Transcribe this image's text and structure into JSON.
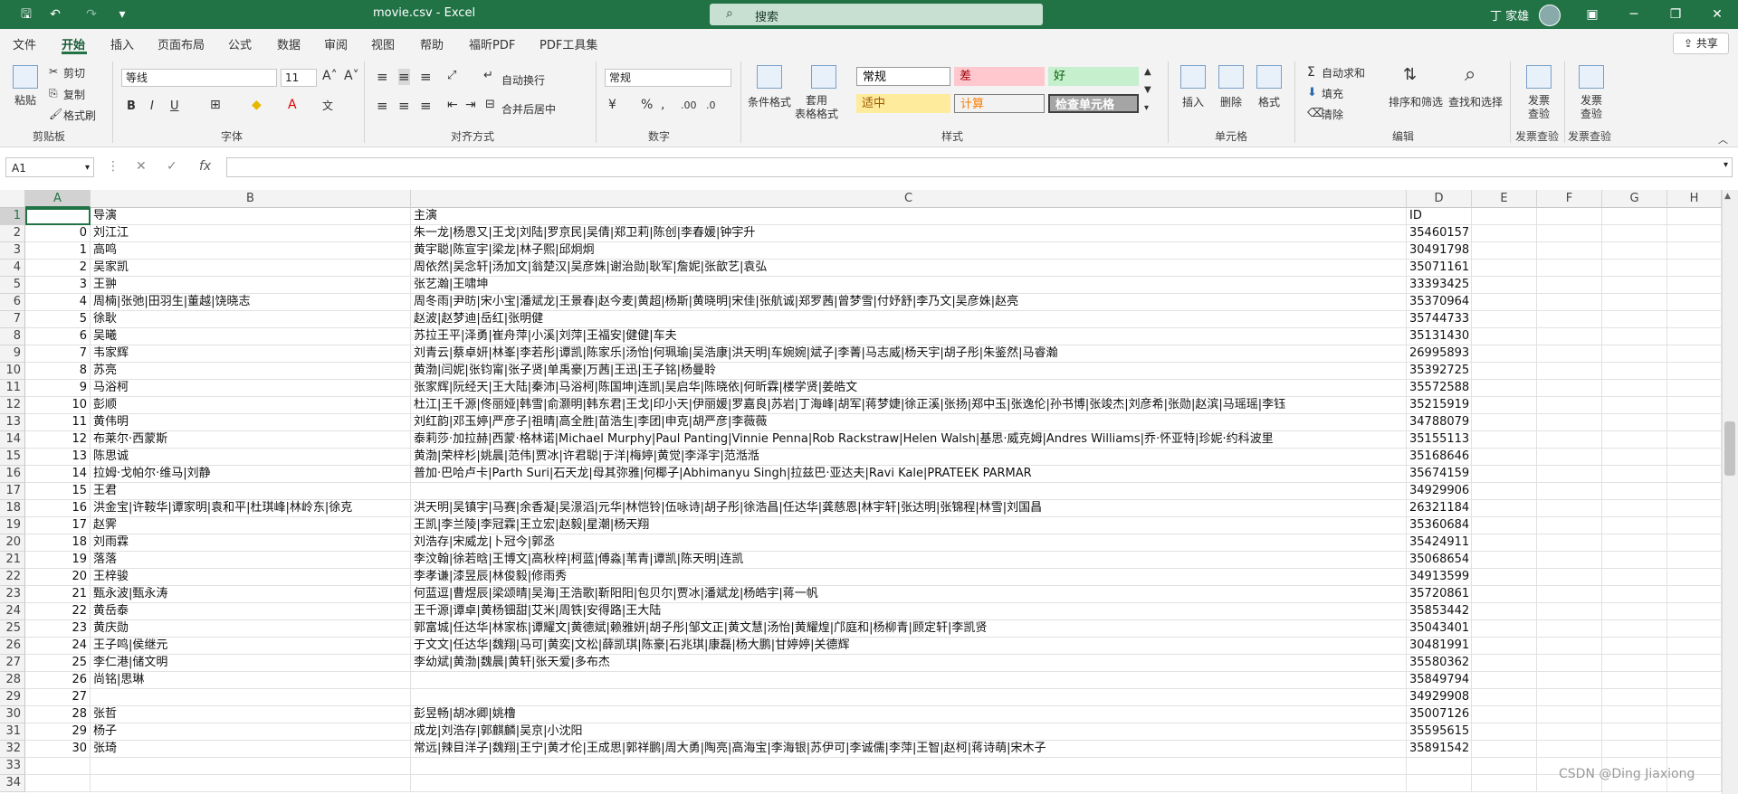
{
  "window": {
    "title": "movie.csv  -  Excel",
    "search_placeholder": "搜索",
    "user": "丁 家雄",
    "controls": [
      "▣",
      "─",
      "❐",
      "✕"
    ]
  },
  "menu": {
    "tabs": [
      "文件",
      "开始",
      "插入",
      "页面布局",
      "公式",
      "数据",
      "审阅",
      "视图",
      "帮助",
      "福昕PDF",
      "PDF工具集"
    ],
    "share": "共享"
  },
  "ribbon": {
    "clipboard": {
      "paste": "粘贴",
      "cut": "剪切",
      "copy": "复制",
      "format_painter": "格式刷",
      "group": "剪贴板"
    },
    "font": {
      "name": "等线",
      "size": "11",
      "bold": "B",
      "italic": "I",
      "underline": "U",
      "group": "字体"
    },
    "alignment": {
      "wrap": "自动换行",
      "merge": "合并后居中",
      "group": "对齐方式"
    },
    "number": {
      "format": "常规",
      "group": "数字"
    },
    "styles": {
      "cond_format": "条件格式",
      "table_format": "套用\n表格格式",
      "cells": [
        {
          "label": "常规",
          "bg": "#ffffff",
          "fg": "#000000"
        },
        {
          "label": "差",
          "bg": "#ffc7ce",
          "fg": "#9c0006"
        },
        {
          "label": "好",
          "bg": "#c6efce",
          "fg": "#006100"
        },
        {
          "label": "适中",
          "bg": "#ffeb9c",
          "fg": "#9c5700"
        },
        {
          "label": "计算",
          "bg": "#f2f2f2",
          "fg": "#fa7d00"
        },
        {
          "label": "检查单元格",
          "bg": "#a5a5a5",
          "fg": "#ffffff"
        }
      ],
      "group": "样式"
    },
    "cells": {
      "insert": "插入",
      "delete": "删除",
      "format": "格式",
      "group": "单元格"
    },
    "editing": {
      "autosum": "自动求和",
      "fill": "填充",
      "clear": "清除",
      "sort": "排序和筛选",
      "find": "查找和选择",
      "group": "编辑"
    },
    "invoice1": {
      "label": "发票\n查验",
      "group": "发票查验"
    },
    "invoice2": {
      "label": "发票\n查验",
      "group": "发票查验"
    }
  },
  "formula_bar": {
    "name_box": "A1",
    "formula": ""
  },
  "sheet": {
    "columns": [
      "A",
      "B",
      "C",
      "D",
      "E",
      "F",
      "G",
      "H"
    ],
    "rows": [
      [
        "",
        "导演",
        "主演",
        "ID"
      ],
      [
        "0",
        "刘江江",
        "朱一龙|杨恩又|王戈|刘陆|罗京民|吴倩|郑卫莉|陈创|李春媛|钟宇升",
        "35460157"
      ],
      [
        "1",
        "高鸣",
        "黄宇聪|陈宣宇|梁龙|林子熙|邱炯炯",
        "30491798"
      ],
      [
        "2",
        "吴家凯",
        "周依然|吴念轩|汤加文|翁楚汉|吴彦姝|谢治勋|耿军|詹妮|张歆艺|袁弘",
        "35071161"
      ],
      [
        "3",
        "王翀",
        "张艺瀚|王啸坤",
        "33393425"
      ],
      [
        "4",
        "周楠|张弛|田羽生|董越|饶晓志",
        "周冬雨|尹昉|宋小宝|潘斌龙|王景春|赵今麦|黄超|杨斯|黄晓明|宋佳|张航诚|郑罗茜|曾梦雪|付妤舒|李乃文|吴彦姝|赵亮",
        "35370964"
      ],
      [
        "5",
        "徐耿",
        "赵波|赵梦迪|岳红|张明健",
        "35744733"
      ],
      [
        "6",
        "吴曦",
        "苏拉王平|泽勇|崔舟萍|小溪|刘萍|王福安|健健|车夫",
        "35131430"
      ],
      [
        "7",
        "韦家辉",
        "刘青云|蔡卓妍|林峯|李若彤|谭凯|陈家乐|汤怡|何珮瑜|吴浩康|洪天明|车婉婉|斌子|李菁|马志威|杨天宇|胡子彤|朱鉴然|马睿瀚",
        "26995893"
      ],
      [
        "8",
        "苏亮",
        "黄渤|闫妮|张钧甯|张子贤|单禹豪|万茜|王迅|王子铭|杨曼聆",
        "35392725"
      ],
      [
        "9",
        "马浴柯",
        "张家辉|阮经天|王大陆|秦沛|马浴柯|陈国坤|连凯|吴启华|陈晓依|何昕霖|楼学贤|姜皓文",
        "35572588"
      ],
      [
        "10",
        "彭顺",
        "杜江|王千源|佟丽娅|韩雪|俞灏明|韩东君|王戈|印小天|伊丽媛|罗嘉良|苏岩|丁海峰|胡军|蒋梦婕|徐正溪|张扬|郑中玉|张逸伦|孙书博|张竣杰|刘彦希|张勋|赵滨|马瑶瑶|李钰",
        "35215919"
      ],
      [
        "11",
        "黄伟明",
        "刘红韵|邓玉婷|严彦子|祖晴|高全胜|苗浩生|李团|申克|胡严彦|李薇薇",
        "34788079"
      ],
      [
        "12",
        "布莱尔·西蒙斯",
        "泰莉莎·加拉赫|西蒙·格林诺|Michael Murphy|Paul Panting|Vinnie Penna|Rob Rackstraw|Helen Walsh|基思·威克姆|Andres Williams|乔·怀亚特|珍妮·约科波里",
        "35155113"
      ],
      [
        "13",
        "陈思诚",
        "黄渤|荣梓杉|姚晨|范伟|贾冰|许君聪|于洋|梅婷|黄觉|李泽宇|范湉湉",
        "35168646"
      ],
      [
        "14",
        "拉姆·戈帕尔·维马|刘静",
        "普加·巴哈卢卡|Parth Suri|石天龙|母其弥雅|何椰子|Abhimanyu Singh|拉兹巴·亚达夫|Ravi Kale|PRATEEK PARMAR",
        "35674159"
      ],
      [
        "15",
        "王君",
        "",
        "34929906"
      ],
      [
        "16",
        "洪金宝|许鞍华|谭家明|袁和平|杜琪峰|林岭东|徐克",
        "洪天明|吴镇宇|马赛|余香凝|吴澋滔|元华|林恺铃|伍咏诗|胡子彤|徐浩昌|任达华|龚慈恩|林宇轩|张达明|张锦程|林雪|刘国昌",
        "26321184"
      ],
      [
        "17",
        "赵霁",
        "王凯|李兰陵|李冠霖|王立宏|赵毅|星潮|杨天翔",
        "35360684"
      ],
      [
        "18",
        "刘雨霖",
        "刘浩存|宋威龙|卜冠今|郭丞",
        "35424911"
      ],
      [
        "19",
        "落落",
        "李汶翰|徐若晗|王博文|高秋梓|柯蓝|傅淼|苇青|谭凯|陈天明|连凯",
        "35068654"
      ],
      [
        "20",
        "王梓骏",
        "李孝谦|漆昱辰|林俊毅|修雨秀",
        "34913599"
      ],
      [
        "21",
        "甄永波|甄永涛",
        "何蓝逗|曹煜辰|梁颂晴|吴海|王浩歌|靳阳阳|包贝尔|贾冰|潘斌龙|杨皓宇|蒋一帆",
        "35720861"
      ],
      [
        "22",
        "黄岳泰",
        "王千源|谭卓|黄杨钿甜|艾米|周铁|安得路|王大陆",
        "35853442"
      ],
      [
        "23",
        "黄庆勋",
        "郭富城|任达华|林家栋|谭耀文|黄德斌|赖雅妍|胡子彤|邹文正|黄文慧|汤怡|黄耀煌|邝庭和|杨柳青|顾定轩|李凯贤",
        "35043401"
      ],
      [
        "24",
        "王子鸣|侯继元",
        "于文文|任达华|魏翔|马可|黄奕|文松|薛凯琪|陈豪|石兆琪|康磊|杨大鹏|甘婷婷|关德辉",
        "30481991"
      ],
      [
        "25",
        "李仁港|储文明",
        "李幼斌|黄渤|魏晨|黄轩|张天爱|多布杰",
        "35580362"
      ],
      [
        "26",
        "尚铭|思琳",
        "",
        "35849794"
      ],
      [
        "27",
        "",
        "",
        "34929908"
      ],
      [
        "28",
        "张哲",
        "彭昱畅|胡冰卿|姚橹",
        "35007126"
      ],
      [
        "29",
        "杨子",
        "成龙|刘浩存|郭麒麟|吴京|小沈阳",
        "35595615"
      ],
      [
        "30",
        "张琦",
        "常远|辣目洋子|魏翔|王宁|黄才伦|王成思|郭祥鹏|周大勇|陶亮|高海宝|李海银|苏伊可|李诚儒|李萍|王智|赵柯|蒋诗萌|宋木子",
        "35891542"
      ],
      [
        "",
        "",
        "",
        ""
      ],
      [
        "",
        "",
        "",
        ""
      ]
    ]
  },
  "watermark": "CSDN @Ding Jiaxiong"
}
